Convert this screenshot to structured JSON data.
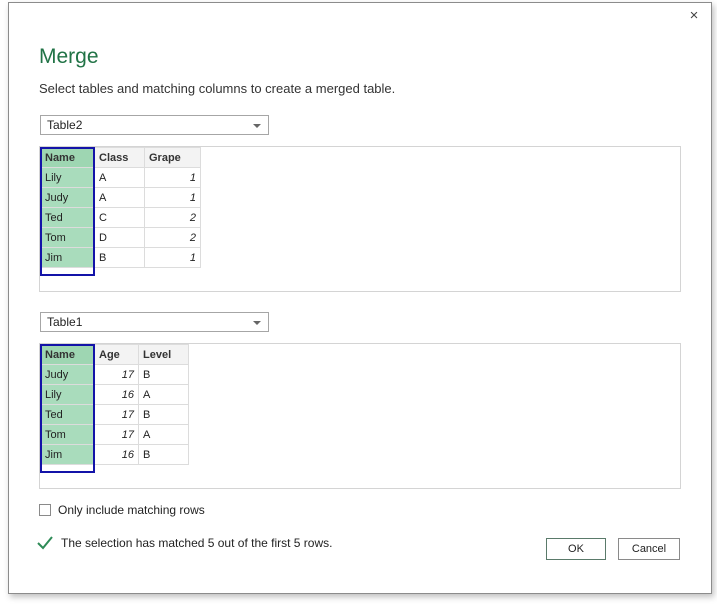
{
  "dialog": {
    "title": "Merge",
    "subtitle": "Select tables and matching columns to create a merged table.",
    "close_glyph": "×"
  },
  "table_top": {
    "selected": "Table2",
    "columns": [
      "Name",
      "Class",
      "Grape"
    ],
    "rows": [
      [
        "Lily",
        "A",
        "1"
      ],
      [
        "Judy",
        "A",
        "1"
      ],
      [
        "Ted",
        "C",
        "2"
      ],
      [
        "Tom",
        "D",
        "2"
      ],
      [
        "Jim",
        "B",
        "1"
      ]
    ]
  },
  "table_bottom": {
    "selected": "Table1",
    "columns": [
      "Name",
      "Age",
      "Level"
    ],
    "rows": [
      [
        "Judy",
        "17",
        "B"
      ],
      [
        "Lily",
        "16",
        "A"
      ],
      [
        "Ted",
        "17",
        "B"
      ],
      [
        "Tom",
        "17",
        "A"
      ],
      [
        "Jim",
        "16",
        "B"
      ]
    ]
  },
  "options": {
    "only_matching_label": "Only include matching rows",
    "only_matching_checked": false
  },
  "status": {
    "icon": "checkmark-icon",
    "text": "The selection has matched 5 out of the first 5 rows."
  },
  "buttons": {
    "ok": "OK",
    "cancel": "Cancel"
  },
  "colors": {
    "accent_title": "#217346",
    "key_column": "#a9dcbc",
    "key_highlight_border": "#1313a8",
    "check_green": "#2e8b57"
  }
}
